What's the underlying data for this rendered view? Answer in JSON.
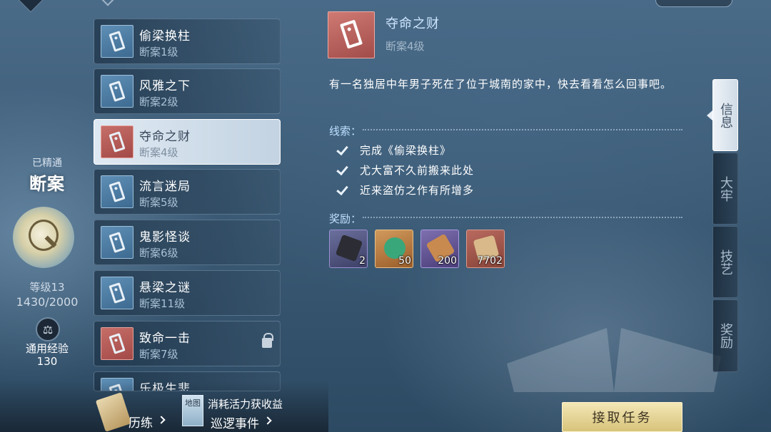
{
  "profile": {
    "mastered_label": "已精通",
    "skill_name": "断案",
    "level": "等级13",
    "exp_progress": "1430/2000",
    "exp_label": "通用经验",
    "exp_value": "130"
  },
  "cases": [
    {
      "name": "偷梁换柱",
      "level": "断案1级",
      "color": "blue",
      "selected": false,
      "locked": false
    },
    {
      "name": "风雅之下",
      "level": "断案2级",
      "color": "blue",
      "selected": false,
      "locked": false
    },
    {
      "name": "夺命之财",
      "level": "断案4级",
      "color": "red",
      "selected": true,
      "locked": false
    },
    {
      "name": "流言迷局",
      "level": "断案5级",
      "color": "blue",
      "selected": false,
      "locked": false
    },
    {
      "name": "鬼影怪谈",
      "level": "断案6级",
      "color": "blue",
      "selected": false,
      "locked": false
    },
    {
      "name": "悬梁之谜",
      "level": "断案11级",
      "color": "blue",
      "selected": false,
      "locked": false
    },
    {
      "name": "致命一击",
      "level": "断案7级",
      "color": "red",
      "selected": false,
      "locked": true
    },
    {
      "name": "乐极生悲",
      "level": "",
      "color": "blue",
      "selected": false,
      "locked": false
    }
  ],
  "bottom": {
    "train_label": "历练",
    "map_label": "地图",
    "patrol_sub": "消耗活力获收益",
    "patrol_label": "巡逻事件"
  },
  "detail": {
    "title": "夺命之财",
    "level": "断案4级",
    "description": "有一名独居中年男子死在了位于城南的家中，快去看看怎么回事吧。",
    "clues_header": "线索：",
    "clues": [
      "完成《偷梁换柱》",
      "尤大富不久前搬来此处",
      "近来盗仿之作有所增多"
    ],
    "rewards_header": "奖励：",
    "rewards": [
      {
        "count": "2",
        "icon": "ore-icon",
        "color": "purple"
      },
      {
        "count": "50",
        "icon": "jade-icon",
        "color": "orange"
      },
      {
        "count": "200",
        "icon": "scroll-bundle-icon",
        "color": "purple"
      },
      {
        "count": "7702",
        "icon": "map-scroll-icon",
        "color": "red"
      }
    ]
  },
  "tabs": [
    {
      "label": "信息",
      "active": true
    },
    {
      "label": "大牢",
      "active": false
    },
    {
      "label": "技艺",
      "active": false
    },
    {
      "label": "奖励",
      "active": false
    }
  ],
  "accept_button": "接取任务"
}
